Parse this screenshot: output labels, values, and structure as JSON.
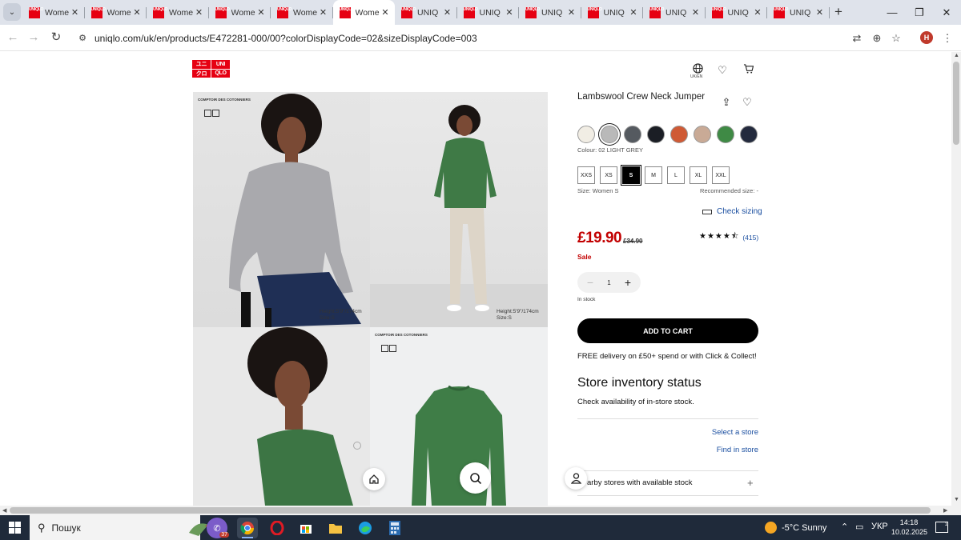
{
  "browser": {
    "tabs": [
      {
        "title": "Wome",
        "favicon": "UNIQLO",
        "active": false
      },
      {
        "title": "Wome",
        "favicon": "UNIQLO",
        "active": false
      },
      {
        "title": "Wome",
        "favicon": "UNIQLO",
        "active": false
      },
      {
        "title": "Wome",
        "favicon": "UNIQLO",
        "active": false
      },
      {
        "title": "Wome",
        "favicon": "UNIQLO",
        "active": false
      },
      {
        "title": "Wome",
        "favicon": "UNIQLO",
        "active": true
      },
      {
        "title": "UNIQ",
        "favicon": "UNIQLO",
        "active": false
      },
      {
        "title": "UNIQ",
        "favicon": "UNIQLO",
        "active": false
      },
      {
        "title": "UNIQ",
        "favicon": "UNIQLO",
        "active": false
      },
      {
        "title": "UNIQ",
        "favicon": "UNIQLO",
        "active": false
      },
      {
        "title": "UNIQ",
        "favicon": "UNIQLO",
        "active": false
      },
      {
        "title": "UNIQ",
        "favicon": "UNIQLO",
        "active": false
      },
      {
        "title": "UNIQ",
        "favicon": "UNIQLO",
        "active": false
      }
    ],
    "url_host": "uniqlo.com",
    "url_path": "/uk/en/products/E472281-000/00?colorDisplayCode=02&sizeDisplayCode=003",
    "profile_initial": "H"
  },
  "site": {
    "logo": [
      "UNI",
      "QLO",
      "ユニ",
      "クロ"
    ],
    "region_label": "UK/EN"
  },
  "gallery": {
    "brand_tag": "COMPTOIR DES COTONNIERS",
    "caption1": "Height:5'9\"/174cm Size:S",
    "caption1_a": "Height:5'9\"/174cm",
    "caption1_b": "Size:S",
    "caption2_a": "Height:5'9\"/174cm",
    "caption2_b": "Size:S"
  },
  "product": {
    "name": "Lambswool Crew Neck Jumper",
    "swatches": [
      {
        "color": "#f1ede4",
        "selected": false
      },
      {
        "color": "#b9b9b9",
        "selected": true
      },
      {
        "color": "#555a60",
        "selected": false
      },
      {
        "color": "#1b1e25",
        "selected": false
      },
      {
        "color": "#cf5a35",
        "selected": false
      },
      {
        "color": "#c9aa96",
        "selected": false
      },
      {
        "color": "#3f8a45",
        "selected": false
      },
      {
        "color": "#232a3d",
        "selected": false
      }
    ],
    "colour_label": "Colour: 02 LIGHT GREY",
    "sizes": [
      {
        "label": "XXS",
        "selected": false
      },
      {
        "label": "XS",
        "selected": false
      },
      {
        "label": "S",
        "selected": true
      },
      {
        "label": "M",
        "selected": false
      },
      {
        "label": "L",
        "selected": false
      },
      {
        "label": "XL",
        "selected": false
      },
      {
        "label": "XXL",
        "selected": false
      }
    ],
    "size_label": "Size: Women S",
    "recommended_label": "Recommended size: -",
    "check_sizing": "Check sizing",
    "price": "£19.90",
    "old_price": "£34.90",
    "sale": "Sale",
    "stars": "★★★★⯪",
    "review_count": "(415)",
    "quantity": "1",
    "qty_minus": "−",
    "qty_plus": "+",
    "stock_status": "In stock",
    "add_to_cart": "ADD TO CART",
    "delivery_note": "FREE delivery on £50+ spend or with Click & Collect!",
    "inventory_title": "Store inventory status",
    "inventory_sub": "Check availability of in-store stock.",
    "select_store": "Select a store",
    "find_in_store": "Find in store",
    "nearby_stores": "arby stores with available stock",
    "nearby_plus": "+"
  },
  "taskbar": {
    "search_placeholder": "Пошук",
    "weather": "-5°C  Sunny",
    "lang": "УКР",
    "time": "14:18",
    "date": "10.02.2025",
    "viber_badge": "37",
    "notif_count": "1"
  },
  "accent": {
    "brand": "#e60012",
    "price": "#c20000",
    "link": "#1b4fa0"
  }
}
